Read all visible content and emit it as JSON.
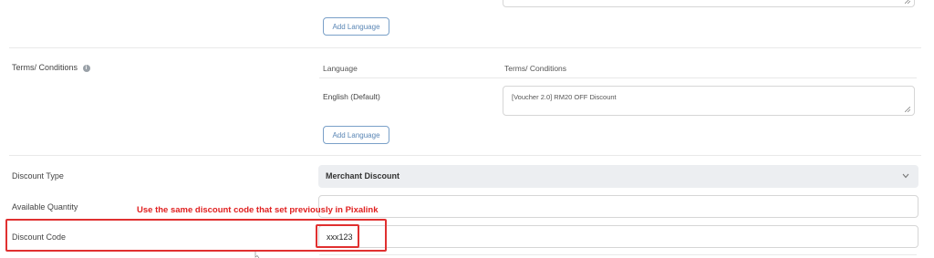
{
  "buttons": {
    "add_language_1": "Add Language",
    "add_language_2": "Add Language"
  },
  "terms": {
    "label": "Terms/ Conditions",
    "col_language": "Language",
    "col_terms": "Terms/ Conditions",
    "row_language": "English (Default)",
    "row_value": "[Voucher 2.0] RM20 OFF Discount"
  },
  "discount_type": {
    "label": "Discount Type",
    "selected": "Merchant Discount"
  },
  "available_quantity": {
    "label": "Available Quantity",
    "value": ""
  },
  "discount_code": {
    "label": "Discount Code",
    "value": "xxx123"
  },
  "annotation": {
    "text": "Use the same discount code that set previously in Pixalink",
    "color": "#e02020"
  }
}
